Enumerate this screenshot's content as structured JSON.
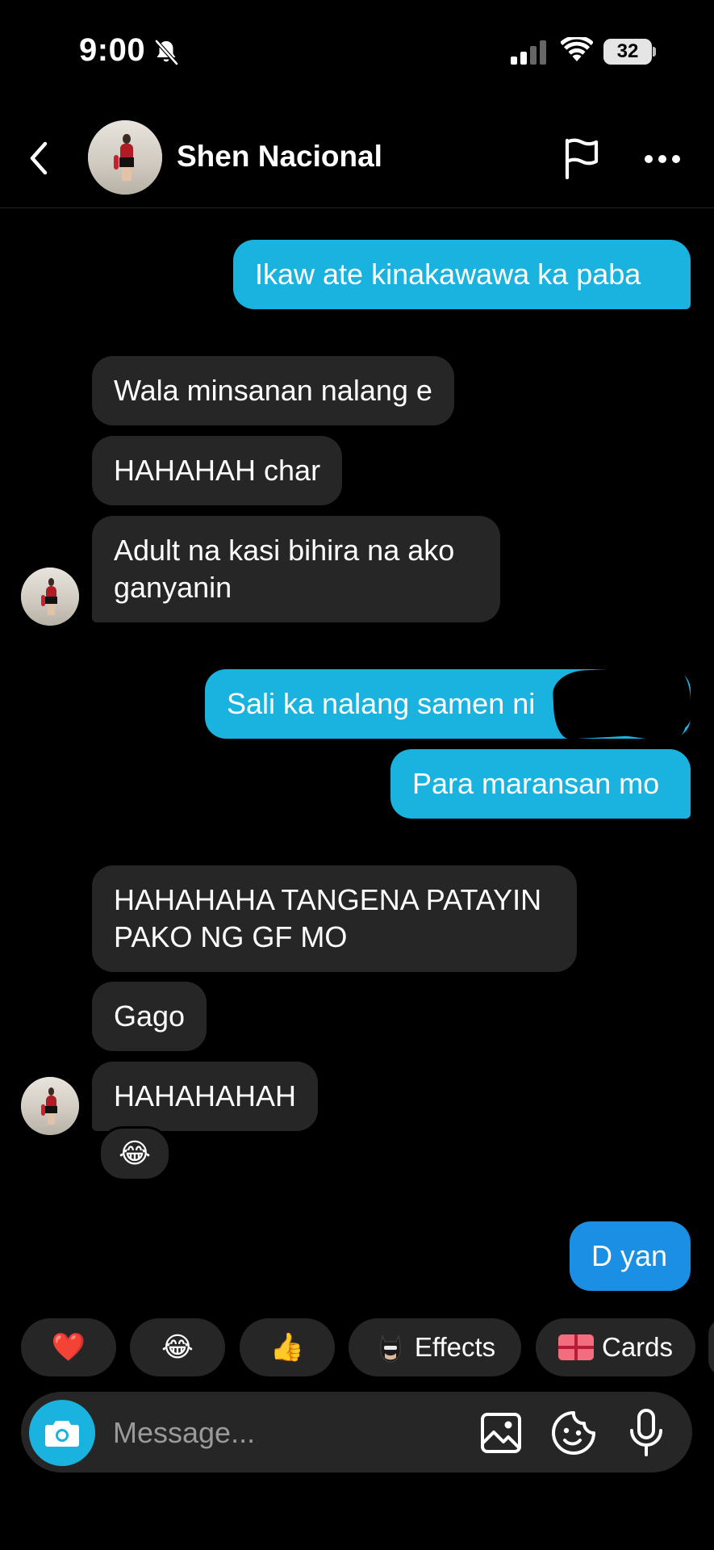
{
  "status_bar": {
    "time": "9:00",
    "battery": "32"
  },
  "header": {
    "contact_name": "Shen Nacional"
  },
  "messages": [
    {
      "from": "me",
      "text": "Ikaw ate kinakawawa ka paba"
    },
    {
      "from": "them",
      "text": "Wala minsanan nalang e"
    },
    {
      "from": "them",
      "text": "HAHAHAH char"
    },
    {
      "from": "them",
      "text": "Adult na kasi bihira na ako\nganyanin"
    },
    {
      "from": "me",
      "text": "Sali ka nalang samen ni"
    },
    {
      "from": "me",
      "text": "Para maransan mo"
    },
    {
      "from": "them",
      "text": "HAHAHAHA TANGENA PATAYIN\nPAKO NG GF MO"
    },
    {
      "from": "them",
      "text": "Gago"
    },
    {
      "from": "them",
      "text": "HAHAHAHAH",
      "reaction": "😂"
    },
    {
      "from": "me",
      "text": "D yan"
    }
  ],
  "quick_reactions": [
    {
      "emoji": "❤️"
    },
    {
      "emoji": "😂"
    },
    {
      "emoji": "👍"
    },
    {
      "icon": "batman-icon",
      "label": "Effects"
    },
    {
      "icon": "gift-card-icon",
      "label": "Cards"
    }
  ],
  "composer": {
    "placeholder": "Message..."
  },
  "colors": {
    "outgoing": "#1ab3e0",
    "outgoing_last": "#1a8fe3",
    "incoming": "#262626",
    "background": "#000000"
  }
}
